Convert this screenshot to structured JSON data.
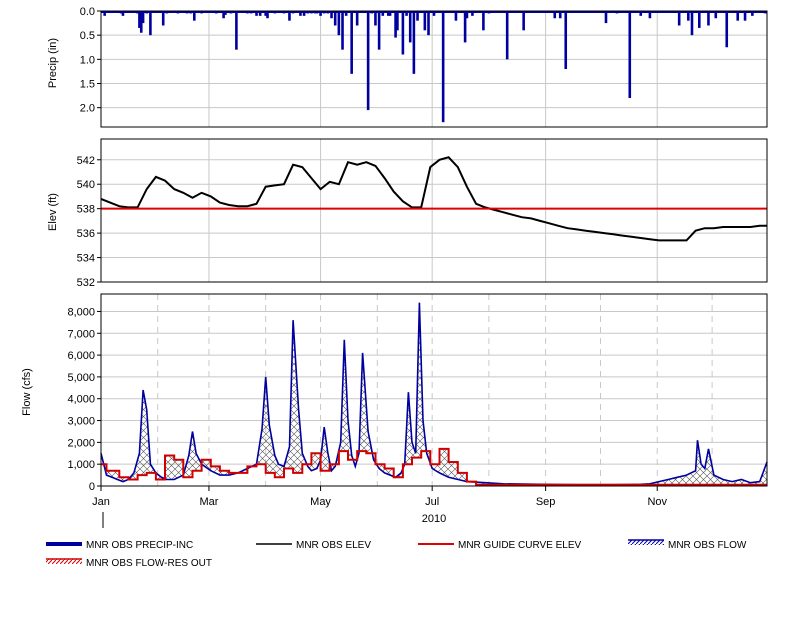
{
  "colors": {
    "precip": "#0000a0",
    "elev": "#000000",
    "guide": "#e00000",
    "flow": "#0000a0",
    "flow_res": "#d00000",
    "grid": "#c8c8c8",
    "frame": "#000000"
  },
  "chart_data": [
    {
      "type": "bar",
      "ylabel": "Precip (in)",
      "ylim": [
        2.4,
        0.0
      ],
      "y_inverted": true,
      "yticks": [
        "0.0",
        "0.5",
        "1.0",
        "1.5",
        "2.0"
      ],
      "ytick_values": [
        0.0,
        0.5,
        1.0,
        1.5,
        2.0
      ],
      "grid": true,
      "series": [
        {
          "legend": "MNR OBS PRECIP-INC",
          "days": [
            2,
            11,
            12,
            20,
            21,
            22,
            23,
            25,
            27,
            34,
            36,
            42,
            47,
            49,
            51,
            55,
            63,
            67,
            68,
            71,
            74,
            80,
            82,
            85,
            87,
            90,
            91,
            95,
            100,
            103,
            105,
            109,
            111,
            113,
            115,
            117,
            118,
            120,
            122,
            124,
            126,
            128,
            130,
            132,
            134,
            137,
            140,
            146,
            148,
            150,
            152,
            154,
            157,
            158,
            161,
            162,
            165,
            167,
            169,
            171,
            173,
            177,
            179,
            182,
            187,
            194,
            199,
            200,
            203,
            209,
            212,
            222,
            231,
            248,
            251,
            254,
            276,
            282,
            289,
            295,
            300,
            316,
            321,
            323,
            327,
            332,
            336,
            342,
            348,
            352,
            356,
            363
          ],
          "values": [
            0.1,
            0.05,
            0.1,
            0.05,
            0.35,
            0.45,
            0.25,
            0.05,
            0.5,
            0.3,
            0.05,
            0.05,
            0.05,
            0.05,
            0.2,
            0.05,
            0.05,
            0.15,
            0.08,
            0.05,
            0.8,
            0.05,
            0.05,
            0.1,
            0.1,
            0.1,
            0.15,
            0.05,
            0.05,
            0.2,
            0.05,
            0.1,
            0.1,
            0.05,
            0.05,
            0.05,
            0.05,
            0.1,
            0.05,
            0.05,
            0.15,
            0.3,
            0.5,
            0.8,
            0.1,
            1.3,
            0.3,
            2.05,
            0.05,
            0.3,
            0.8,
            0.1,
            0.1,
            0.1,
            0.55,
            0.4,
            0.9,
            0.1,
            0.65,
            1.3,
            0.2,
            0.4,
            0.5,
            0.1,
            2.3,
            0.2,
            0.65,
            0.15,
            0.1,
            0.4,
            0.05,
            1.0,
            0.4,
            0.15,
            0.15,
            1.2,
            0.25,
            0.05,
            1.8,
            0.1,
            0.15,
            0.3,
            0.2,
            0.5,
            0.35,
            0.3,
            0.15,
            0.75,
            0.2,
            0.2,
            0.1,
            0.05,
            0.05,
            0.2,
            0.1,
            0.05,
            0.05,
            0.55,
            0.2,
            0.4,
            0.6,
            0.1,
            0.8,
            0.05,
            1.6,
            0.1,
            0.2,
            1.6,
            0.05,
            0.2,
            0.05,
            0.1,
            0.25,
            0.1,
            0.2,
            0.15,
            0.05,
            0.3
          ]
        }
      ]
    },
    {
      "type": "line",
      "ylabel": "Elev (ft)",
      "ylim": [
        532,
        543.7
      ],
      "yticks": [
        "532",
        "534",
        "536",
        "538",
        "540",
        "542"
      ],
      "ytick_values": [
        532,
        534,
        536,
        538,
        540,
        542
      ],
      "grid": true,
      "series": [
        {
          "legend": "MNR OBS ELEV",
          "x": [
            0,
            5,
            10,
            15,
            20,
            25,
            30,
            35,
            40,
            45,
            50,
            55,
            60,
            65,
            70,
            75,
            80,
            85,
            90,
            95,
            100,
            105,
            110,
            115,
            120,
            125,
            130,
            135,
            140,
            145,
            150,
            155,
            160,
            165,
            170,
            175,
            180,
            185,
            190,
            195,
            200,
            205,
            210,
            215,
            220,
            225,
            230,
            235,
            240,
            245,
            250,
            255,
            260,
            265,
            270,
            275,
            280,
            285,
            290,
            295,
            300,
            305,
            310,
            315,
            320,
            325,
            330,
            335,
            340,
            345,
            350,
            355,
            360,
            364
          ],
          "y": [
            538.8,
            538.5,
            538.2,
            538.1,
            538.1,
            539.6,
            540.6,
            540.3,
            539.6,
            539.3,
            538.9,
            539.3,
            539.0,
            538.5,
            538.3,
            538.2,
            538.2,
            538.4,
            539.8,
            539.9,
            540.0,
            541.6,
            541.4,
            540.5,
            539.6,
            540.2,
            540.0,
            541.8,
            541.6,
            541.8,
            541.5,
            540.5,
            539.4,
            538.6,
            538.1,
            538.1,
            541.4,
            542.0,
            542.2,
            541.4,
            539.8,
            538.4,
            538.1,
            537.9,
            537.7,
            537.5,
            537.3,
            537.2,
            537.0,
            536.8,
            536.6,
            536.4,
            536.3,
            536.2,
            536.1,
            536.0,
            535.9,
            535.8,
            535.7,
            535.6,
            535.5,
            535.4,
            535.4,
            535.4,
            535.4,
            536.2,
            536.4,
            536.4,
            536.5,
            536.5,
            536.5,
            536.5,
            536.6,
            536.6
          ]
        },
        {
          "legend": "MNR GUIDE CURVE ELEV",
          "x": [
            0,
            364
          ],
          "y": [
            538.0,
            538.0
          ]
        }
      ]
    },
    {
      "type": "area",
      "ylabel": "Flow (cfs)",
      "ylim": [
        0,
        8800
      ],
      "yticks": [
        "0",
        "1,000",
        "2,000",
        "3,000",
        "4,000",
        "5,000",
        "6,000",
        "7,000",
        "8,000"
      ],
      "ytick_values": [
        0,
        1000,
        2000,
        3000,
        4000,
        5000,
        6000,
        7000,
        8000
      ],
      "grid": true,
      "xticks": [
        "Jan",
        "Mar",
        "May",
        "Jul",
        "Sep",
        "Nov"
      ],
      "xtick_days": [
        0,
        59,
        120,
        181,
        243,
        304
      ],
      "xlabel": "2010",
      "series": [
        {
          "legend": "MNR OBS FLOW",
          "x": [
            0,
            3,
            6,
            9,
            12,
            15,
            18,
            21,
            23,
            25,
            27,
            30,
            33,
            36,
            40,
            45,
            48,
            50,
            52,
            55,
            60,
            65,
            70,
            75,
            80,
            85,
            88,
            90,
            92,
            95,
            97,
            100,
            103,
            105,
            108,
            110,
            113,
            115,
            118,
            120,
            122,
            124,
            126,
            128,
            131,
            133,
            135,
            137,
            139,
            141,
            143,
            146,
            149,
            152,
            155,
            158,
            161,
            164,
            166,
            168,
            170,
            172,
            174,
            176,
            178,
            181,
            185,
            190,
            200,
            210,
            220,
            240,
            260,
            280,
            295,
            300,
            305,
            310,
            315,
            320,
            325,
            326,
            328,
            330,
            332,
            335,
            340,
            345,
            350,
            355,
            360,
            364
          ],
          "y": [
            1500,
            500,
            400,
            300,
            200,
            300,
            600,
            1500,
            4400,
            3500,
            1000,
            600,
            400,
            300,
            300,
            500,
            1400,
            2500,
            1500,
            1000,
            700,
            500,
            500,
            600,
            800,
            1000,
            2600,
            5000,
            2800,
            1400,
            1000,
            900,
            1800,
            7600,
            3500,
            1500,
            900,
            700,
            800,
            1200,
            2700,
            1500,
            700,
            900,
            2000,
            6700,
            3000,
            1400,
            900,
            1500,
            6100,
            2500,
            1200,
            800,
            600,
            500,
            400,
            600,
            1000,
            4300,
            2000,
            1500,
            8400,
            3000,
            1500,
            800,
            600,
            400,
            200,
            150,
            100,
            80,
            60,
            60,
            80,
            100,
            200,
            300,
            400,
            500,
            700,
            2100,
            1000,
            800,
            1700,
            500,
            300,
            200,
            300,
            150,
            200,
            1100
          ]
        },
        {
          "legend": "MNR OBS FLOW-RES OUT",
          "x": [
            0,
            3,
            3,
            10,
            10,
            15,
            15,
            20,
            20,
            25,
            25,
            30,
            30,
            35,
            35,
            40,
            40,
            45,
            45,
            50,
            50,
            55,
            55,
            60,
            60,
            65,
            65,
            70,
            70,
            80,
            80,
            85,
            85,
            90,
            90,
            95,
            95,
            100,
            100,
            105,
            105,
            110,
            110,
            115,
            115,
            120,
            120,
            125,
            125,
            130,
            130,
            135,
            135,
            140,
            140,
            145,
            145,
            150,
            150,
            155,
            155,
            160,
            160,
            165,
            165,
            170,
            170,
            175,
            175,
            180,
            180,
            185,
            185,
            190,
            190,
            195,
            195,
            200,
            200,
            205,
            205,
            364
          ],
          "y": [
            1000,
            1000,
            700,
            700,
            400,
            400,
            300,
            300,
            500,
            500,
            600,
            600,
            300,
            300,
            1400,
            1400,
            1200,
            1200,
            400,
            400,
            700,
            700,
            1200,
            1200,
            900,
            900,
            700,
            700,
            600,
            600,
            900,
            900,
            1000,
            1000,
            600,
            600,
            400,
            400,
            800,
            800,
            600,
            600,
            1000,
            1000,
            1500,
            1500,
            700,
            700,
            1000,
            1000,
            1600,
            1600,
            1200,
            1200,
            1600,
            1600,
            1500,
            1500,
            1000,
            1000,
            800,
            800,
            400,
            400,
            1000,
            1000,
            1300,
            1300,
            1600,
            1600,
            1000,
            1000,
            1700,
            1700,
            1100,
            1100,
            600,
            600,
            200,
            200,
            60,
            60
          ]
        }
      ]
    }
  ],
  "legend": [
    {
      "label": "MNR OBS PRECIP-INC"
    },
    {
      "label": "MNR OBS ELEV"
    },
    {
      "label": "MNR GUIDE CURVE ELEV"
    },
    {
      "label": "MNR OBS FLOW"
    },
    {
      "label": "MNR OBS FLOW-RES OUT"
    }
  ]
}
